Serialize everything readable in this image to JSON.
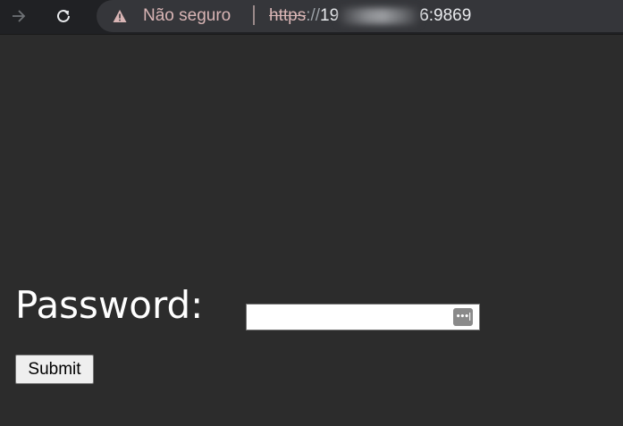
{
  "browser": {
    "forward_icon": "arrow-right-icon",
    "reload_icon": "reload-icon",
    "security_icon": "warning-triangle-icon",
    "security_label": "Não seguro",
    "url": {
      "scheme": "https",
      "separator": "://",
      "host_start": "19",
      "host_end": "6:9869"
    }
  },
  "form": {
    "password_label": "Password:",
    "password_value": "",
    "password_manager_icon": "password-key-icon",
    "submit_label": "Submit"
  },
  "colors": {
    "page_background": "#2c2c2c",
    "toolbar_background": "#202124",
    "omnibox_background": "#35363a",
    "insecure_text": "#d9b5b5"
  }
}
